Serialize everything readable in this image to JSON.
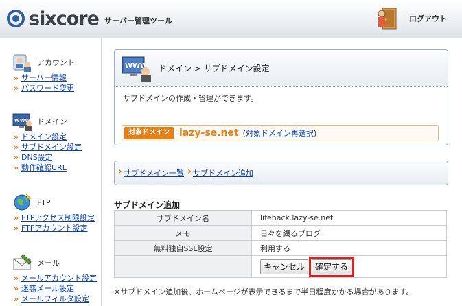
{
  "header": {
    "logo_text": "sixcore",
    "logo_sub": "サーバー管理ツール",
    "logout_label": "ログアウト"
  },
  "sidebar": {
    "groups": [
      {
        "title": "アカウント",
        "icon": "account-icon",
        "links": [
          "サーバー情報",
          "パスワード変更"
        ]
      },
      {
        "title": "ドメイン",
        "icon": "domain-www-icon",
        "links": [
          "ドメイン設定",
          "サブドメイン設定",
          "DNS設定",
          "動作確認URL"
        ]
      },
      {
        "title": "FTP",
        "icon": "ftp-globe-icon",
        "links": [
          "FTPアクセス制限設定",
          "FTPアカウント設定"
        ]
      },
      {
        "title": "メール",
        "icon": "mail-icon",
        "links": [
          "メールアカウント設定",
          "迷惑メール設定",
          "メールフィルタ設定"
        ]
      }
    ]
  },
  "main": {
    "title": "ドメイン > サブドメイン設定",
    "description": "サブドメインの作成・管理ができます。",
    "domain_tag": "対象ドメイン",
    "domain_name": "lazy-se.net",
    "domain_paren_open": "(",
    "domain_reselect": "対象ドメイン再選択",
    "domain_paren_close": ")",
    "breadcrumb": [
      "サブドメイン一覧",
      "サブドメイン追加"
    ],
    "section_title": "サブドメイン追加",
    "form_rows": [
      {
        "label": "サブドメイン名",
        "value": "lifehack.lazy-se.net"
      },
      {
        "label": "メモ",
        "value": "日々を綴るブログ"
      },
      {
        "label": "無料独自SSL設定",
        "value": "利用する"
      }
    ],
    "cancel_label": "キャンセル",
    "confirm_label": "確定する",
    "note": "※サブドメイン追加後、ホームページが表示できるまで半日程度かかる場合があります。"
  },
  "colors": {
    "accent": "#e77f18",
    "link": "#0b3fa8",
    "highlight": "#e41d1d"
  }
}
